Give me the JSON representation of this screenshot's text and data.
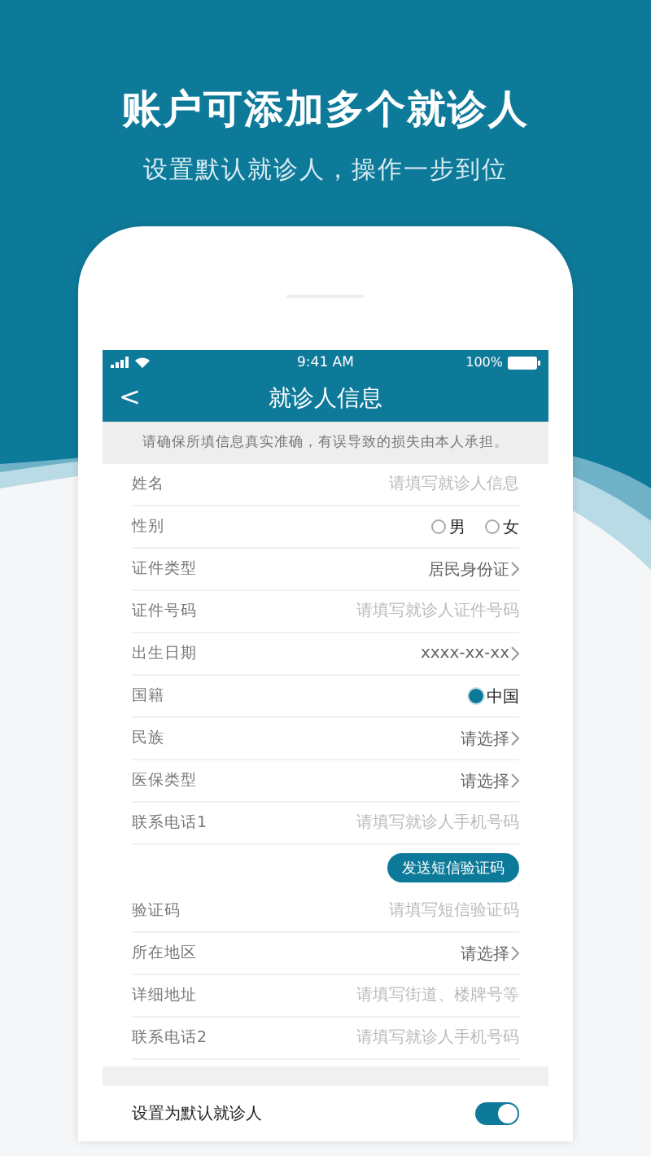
{
  "banner": {
    "title": "账户可添加多个就诊人",
    "subtitle": "设置默认就诊人，操作一步到位"
  },
  "status_bar": {
    "time": "9:41 AM",
    "battery": "100%"
  },
  "nav": {
    "back": "<",
    "title": "就诊人信息"
  },
  "notice": "请确保所填信息真实准确，有误导致的损失由本人承担。",
  "fields": [
    {
      "kind": "input",
      "label": "姓名",
      "placeholder": "请填写就诊人信息"
    },
    {
      "kind": "radio",
      "label": "性别",
      "options": [
        {
          "label": "男",
          "selected": false
        },
        {
          "label": "女",
          "selected": false
        }
      ]
    },
    {
      "kind": "select",
      "label": "证件类型",
      "value": "居民身份证"
    },
    {
      "kind": "input",
      "label": "证件号码",
      "placeholder": "请填写就诊人证件号码"
    },
    {
      "kind": "select",
      "label": "出生日期",
      "value": "xxxx-xx-xx"
    },
    {
      "kind": "radio",
      "label": "国籍",
      "options": [
        {
          "label": "中国",
          "selected": true
        }
      ]
    },
    {
      "kind": "select",
      "label": "民族",
      "value": "请选择"
    },
    {
      "kind": "select",
      "label": "医保类型",
      "value": "请选择"
    },
    {
      "kind": "input",
      "label": "联系电话1",
      "placeholder": "请填写就诊人手机号码"
    },
    {
      "kind": "button",
      "label": "发送短信验证码"
    },
    {
      "kind": "input",
      "label": "验证码",
      "placeholder": "请填写短信验证码"
    },
    {
      "kind": "select",
      "label": "所在地区",
      "value": "请选择"
    },
    {
      "kind": "input",
      "label": "详细地址",
      "placeholder": "请填写街道、楼牌号等"
    },
    {
      "kind": "input",
      "label": "联系电话2",
      "placeholder": "请填写就诊人手机号码"
    }
  ],
  "default_setting": {
    "label": "设置为默认就诊人",
    "on": true
  }
}
